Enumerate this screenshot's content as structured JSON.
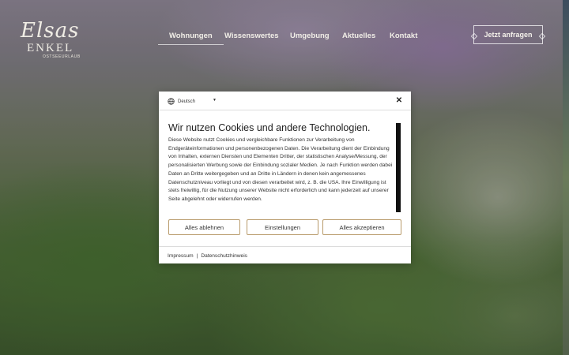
{
  "header": {
    "logo": {
      "script_text": "Elsas",
      "wordmark": "ENKEL",
      "tagline": "OSTSEEURLAUB"
    },
    "nav": [
      {
        "label": "Wohnungen",
        "active": true
      },
      {
        "label": "Wissenswertes",
        "active": false
      },
      {
        "label": "Umgebung",
        "active": false
      },
      {
        "label": "Aktuelles",
        "active": false
      },
      {
        "label": "Kontakt",
        "active": false
      }
    ],
    "cta_label": "Jetzt anfragen"
  },
  "cookie_modal": {
    "language": {
      "label": "Deutsch",
      "icon": "globe-icon",
      "caret_icon": "caret-down-icon"
    },
    "close_icon": "close-icon",
    "title": "Wir nutzen Cookies und andere Technologien.",
    "body": "Diese Website nutzt Cookies und vergleichbare Funktionen zur Verarbeitung von Endgeräteinformationen und personenbezogenen Daten. Die Verarbeitung dient der Einbindung von Inhalten, externen Diensten und Elementen Dritter, der statistischen Analyse/Messung, der personalisierten Werbung sowie der Einbindung sozialer Medien. Je nach Funktion werden dabei Daten an Dritte weitergegeben und an Dritte in Ländern in denen kein angemessenes Datenschutzniveau vorliegt und von diesen verarbeitet wird, z. B. die USA. Ihre Einwilligung ist stets freiwillig, für die Nutzung unserer Website nicht erforderlich und kann jederzeit auf unserer Seite abgelehnt oder widerrufen werden.",
    "buttons": {
      "reject": "Alles ablehnen",
      "settings": "Einstellungen",
      "accept": "Alles akzeptieren"
    },
    "footer": {
      "imprint": "Impressum",
      "separator": "|",
      "privacy": "Datenschutzhinweis"
    }
  },
  "colors": {
    "button_border": "#b89a6a",
    "modal_background": "#ffffff",
    "nav_text": "#f1eee7"
  }
}
